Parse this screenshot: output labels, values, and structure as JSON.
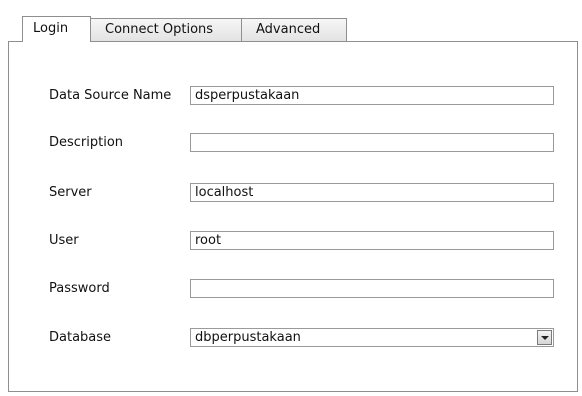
{
  "tabs": [
    {
      "label": "Login",
      "active": true
    },
    {
      "label": "Connect Options",
      "active": false
    },
    {
      "label": "Advanced",
      "active": false
    }
  ],
  "form": {
    "dsn": {
      "label": "Data Source Name",
      "value": "dsperpustakaan"
    },
    "description": {
      "label": "Description",
      "value": ""
    },
    "server": {
      "label": "Server",
      "value": "localhost"
    },
    "user": {
      "label": "User",
      "value": "root"
    },
    "password": {
      "label": "Password",
      "value": ""
    },
    "database": {
      "label": "Database",
      "value": "dbperpustakaan",
      "icon": "chevron-down-icon"
    }
  }
}
